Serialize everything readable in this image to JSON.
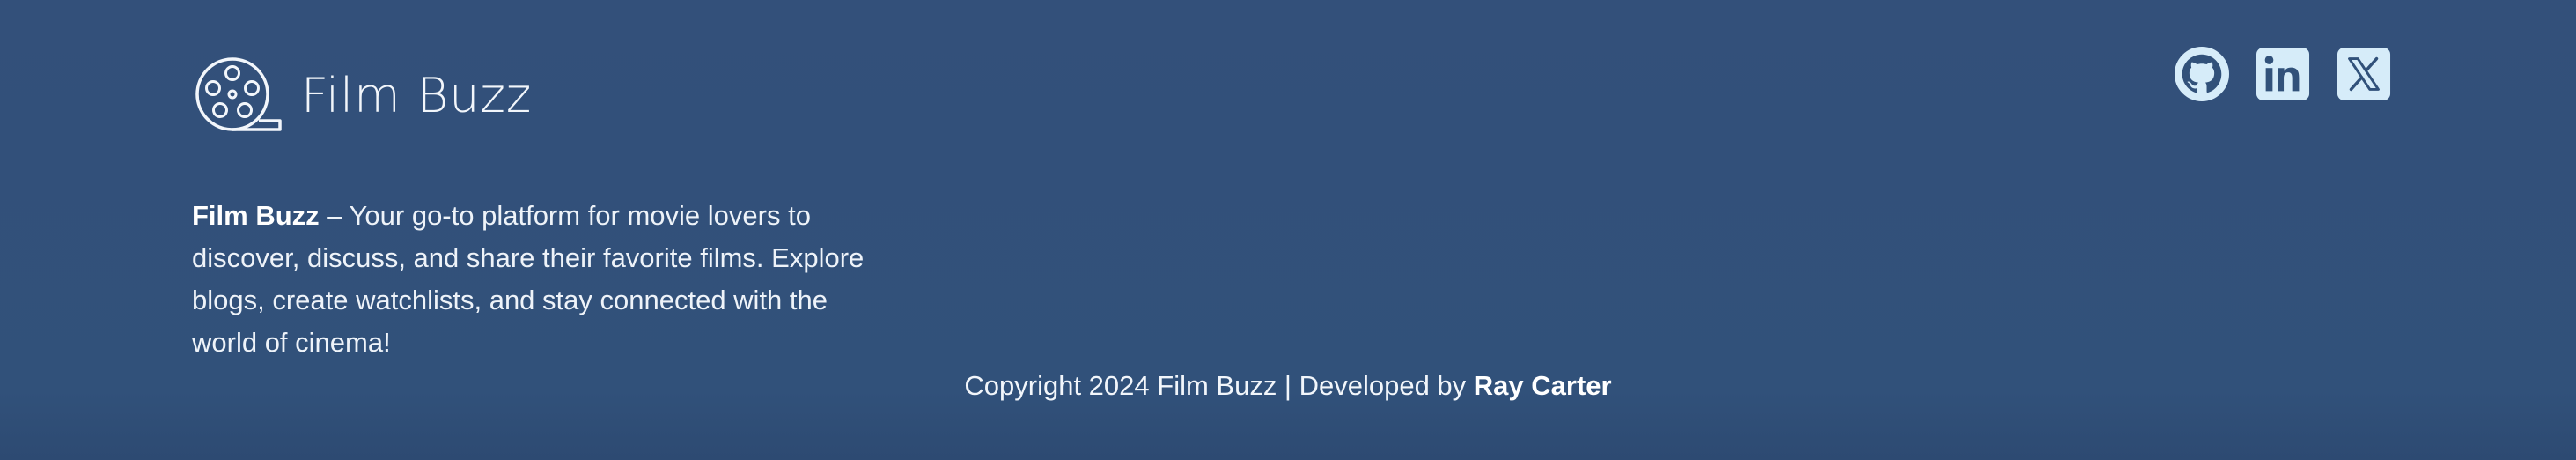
{
  "brand": {
    "name": "Film Buzz",
    "logo_icon": "film-reel-icon"
  },
  "about": {
    "bold": "Film Buzz",
    "text": " – Your go-to platform for movie lovers to discover, discuss, and share their favorite films. Explore blogs, create watchlists, and stay connected with the world of cinema!"
  },
  "socials": [
    {
      "icon": "github-icon"
    },
    {
      "icon": "linkedin-icon"
    },
    {
      "icon": "x-twitter-icon"
    }
  ],
  "footer": {
    "copyright_prefix": "Copyright 2024 Film Buzz | Developed by ",
    "developer": "Ray Carter"
  },
  "colors": {
    "background": "#31517a",
    "icon_tile": "#d6ecf9",
    "text": "#ffffff"
  }
}
